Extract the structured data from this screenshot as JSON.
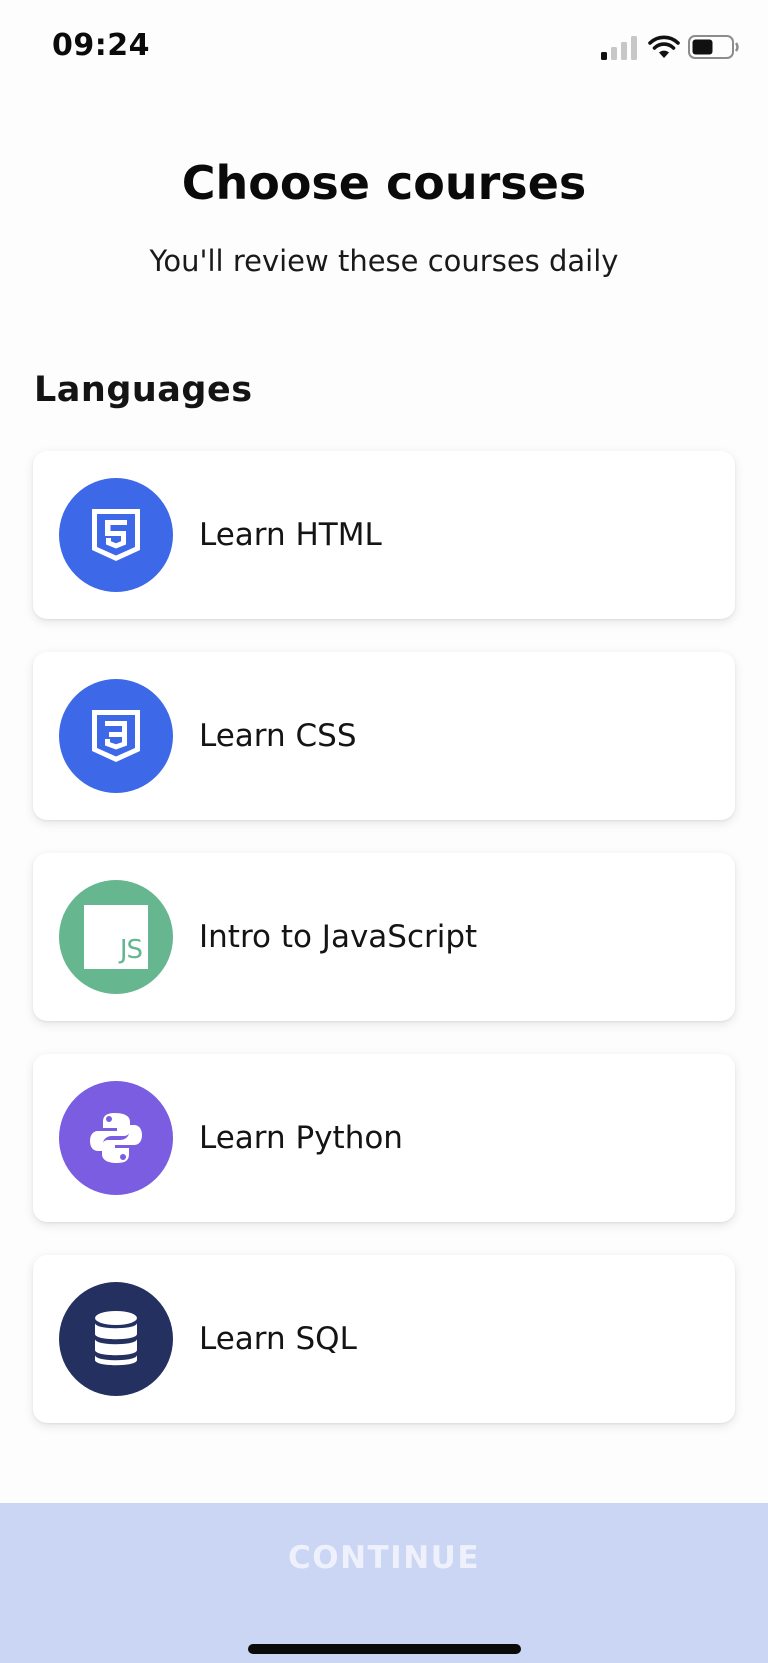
{
  "status_bar": {
    "time": "09:24",
    "icons": [
      "signal-icon",
      "wifi-icon",
      "battery-icon"
    ]
  },
  "header": {
    "title": "Choose courses",
    "subtitle": "You'll review these courses daily"
  },
  "section": {
    "heading": "Languages"
  },
  "courses": [
    {
      "label": "Learn HTML",
      "icon": "html5-icon",
      "color": "#3d68e8"
    },
    {
      "label": "Learn CSS",
      "icon": "css3-icon",
      "color": "#3d68e8"
    },
    {
      "label": "Intro to JavaScript",
      "icon": "javascript-icon",
      "color": "#66b690",
      "icon_text": "JS"
    },
    {
      "label": "Learn Python",
      "icon": "python-icon",
      "color": "#7a5de0"
    },
    {
      "label": "Learn SQL",
      "icon": "database-icon",
      "color": "#243160"
    }
  ],
  "footer": {
    "continue_label": "CONTINUE",
    "button_color": "#cbd5f4"
  }
}
